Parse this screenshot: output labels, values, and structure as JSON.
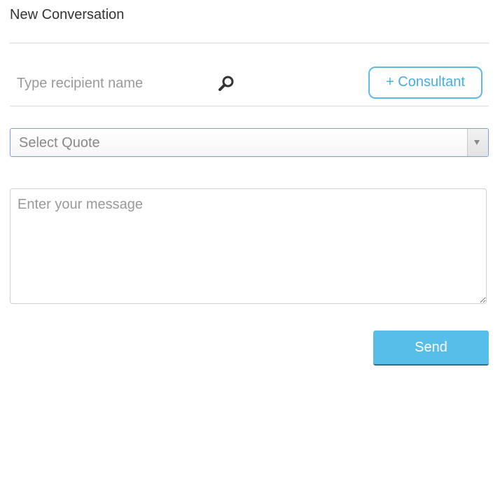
{
  "header": {
    "title": "New Conversation"
  },
  "recipient": {
    "placeholder": "Type recipient name",
    "value": "",
    "search_icon": "search-icon"
  },
  "consultant_button": {
    "label": "+ Consultant"
  },
  "quote_select": {
    "selected": "Select Quote",
    "arrow_icon": "chevron-down-icon"
  },
  "message": {
    "placeholder": "Enter your message",
    "value": ""
  },
  "send_button": {
    "label": "Send"
  },
  "colors": {
    "accent": "#57bde9",
    "consultant_border": "#5bbce6",
    "select_focus_border": "#7da2e0",
    "divider": "#d9d9d9",
    "title_text": "#333333",
    "placeholder_text": "#999999"
  }
}
